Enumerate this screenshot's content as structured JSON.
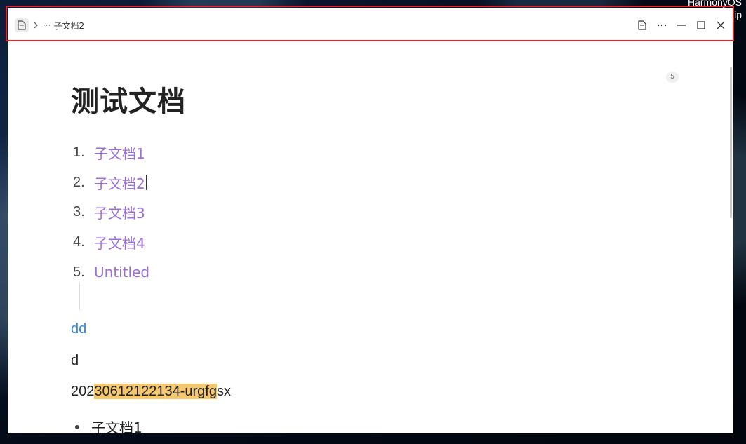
{
  "desktop": {
    "file_label_line1": "HarmonyOS",
    "file_label_line2": "Sans.zip"
  },
  "titlebar": {
    "breadcrumb_prefix": "···",
    "breadcrumb_current": "子文档2"
  },
  "document": {
    "block_count": "5",
    "title": "测试文档",
    "ordered_list": [
      {
        "num": "1.",
        "label": "子文档1"
      },
      {
        "num": "2.",
        "label": "子文档2"
      },
      {
        "num": "3.",
        "label": "子文档3"
      },
      {
        "num": "4.",
        "label": "子文档4"
      },
      {
        "num": "5.",
        "label": "Untitled"
      }
    ],
    "link_paragraph": "dd",
    "plain_paragraph": "d",
    "id_paragraph": {
      "before": "202",
      "highlighted": "30612122134-urgfg",
      "after": "sx"
    },
    "bullet_list": [
      {
        "label": "子文档1"
      }
    ]
  },
  "colors": {
    "link_purple": "#9b70d6",
    "link_blue": "#3a86d8",
    "highlight": "#f5c870",
    "frame_red": "#e0262b"
  }
}
